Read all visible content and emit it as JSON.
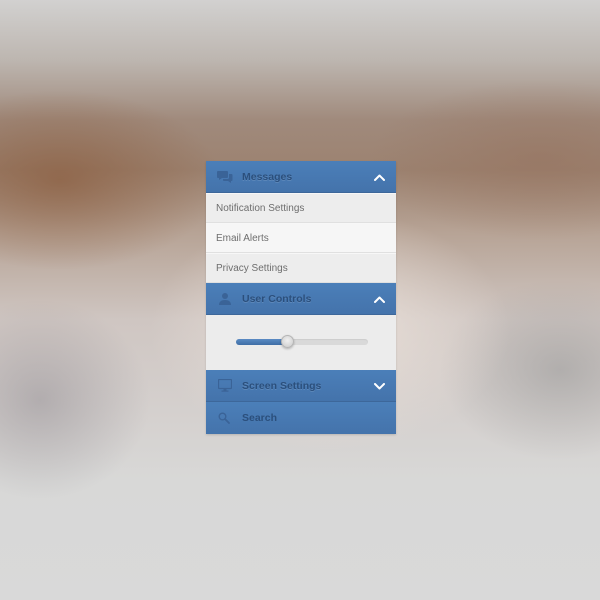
{
  "panel": {
    "sections": {
      "messages": {
        "label": "Messages",
        "icon": "chat-bubbles-icon",
        "expanded": true,
        "items": [
          {
            "label": "Notification Settings",
            "active": false
          },
          {
            "label": "Email Alerts",
            "active": true
          },
          {
            "label": "Privacy Settings",
            "active": false
          }
        ]
      },
      "user_controls": {
        "label": "User Controls",
        "icon": "user-icon",
        "expanded": true,
        "slider_value": 0.39
      },
      "screen_settings": {
        "label": "Screen Settings",
        "icon": "monitor-icon",
        "expanded": false
      },
      "search": {
        "placeholder": "Search",
        "value": "",
        "icon": "search-icon"
      }
    }
  },
  "colors": {
    "header_blue": "#4878b2",
    "header_text": "#2b4f7c",
    "item_bg": "#ededed",
    "item_active_bg": "#f6f6f6",
    "item_text": "#6e6e6e",
    "slider_fill": "#4a7bb5"
  }
}
